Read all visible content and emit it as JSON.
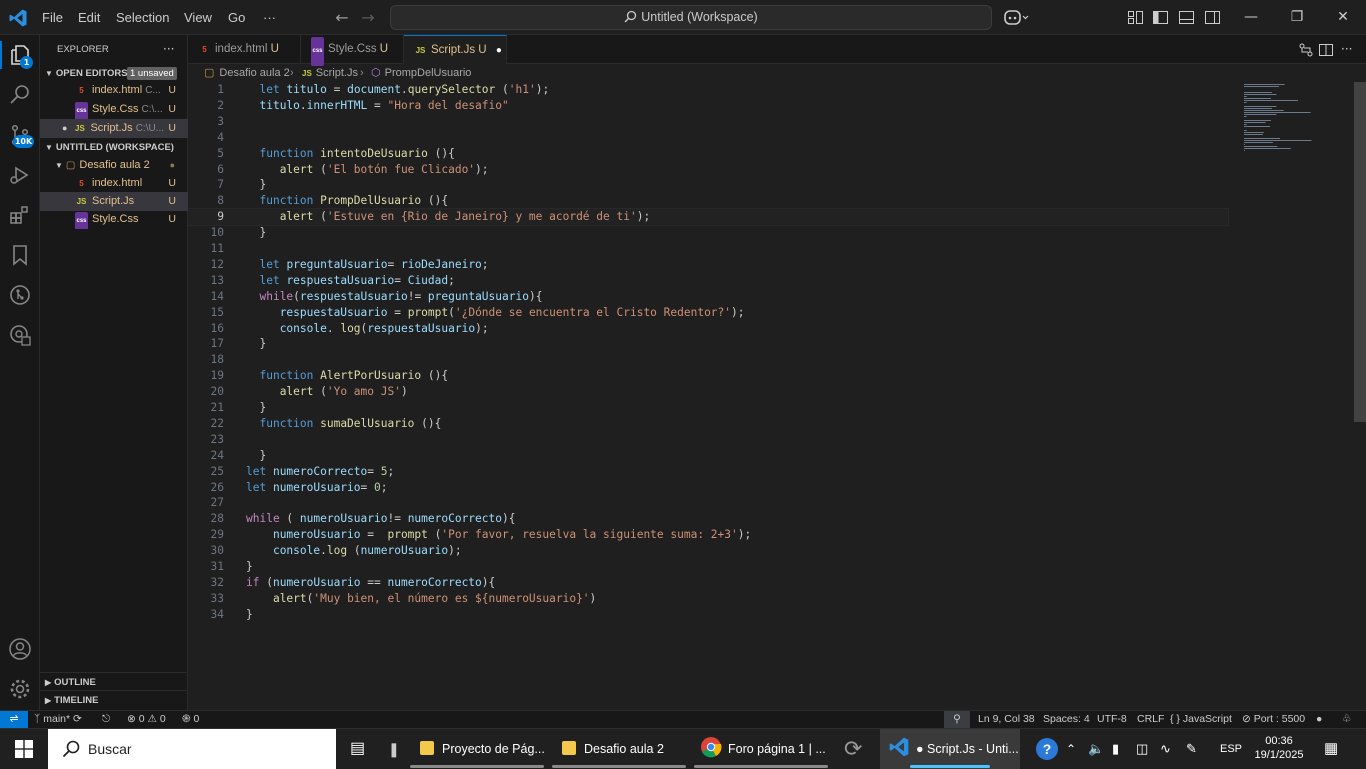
{
  "menu": [
    "File",
    "Edit",
    "Selection",
    "View",
    "Go",
    "···"
  ],
  "search": {
    "text": "Untitled (Workspace)"
  },
  "activity_badges": {
    "source_control": "10K",
    "explorer": "1"
  },
  "sidebar": {
    "title": "EXPLORER",
    "open_editors": {
      "label": "OPEN EDITORS",
      "unsaved": "1 unsaved"
    },
    "open_files": [
      {
        "icon": "5",
        "name": "index.html",
        "path": "C...",
        "status": "U"
      },
      {
        "icon": "css",
        "name": "Style.Css",
        "path": "C:\\...",
        "status": "U"
      },
      {
        "icon": "JS",
        "name": "Script.Js",
        "path": "C:\\U...",
        "status": "U",
        "dot": "●"
      }
    ],
    "workspace": {
      "label": "UNTITLED (WORKSPACE)",
      "folder": "Desafio aula 2",
      "folder_dot": "●"
    },
    "files": [
      {
        "icon": "5",
        "name": "index.html",
        "status": "U"
      },
      {
        "icon": "JS",
        "name": "Script.Js",
        "status": "U"
      },
      {
        "icon": "css",
        "name": "Style.Css",
        "status": "U"
      }
    ],
    "outline": "OUTLINE",
    "timeline": "TIMELINE"
  },
  "tabs": [
    {
      "icon": "5",
      "name": "index.html",
      "status": "U"
    },
    {
      "icon": "css",
      "name": "Style.Css",
      "status": "U"
    },
    {
      "icon": "JS",
      "name": "Script.Js",
      "status": "U",
      "dot": "●"
    }
  ],
  "breadcrumb": {
    "folder": "Desafio aula 2",
    "file_icon": "JS",
    "file": "Script.Js",
    "symbol": "PrompDelUsuario"
  },
  "code": [
    [
      [
        "  ",
        ""
      ],
      [
        "let ",
        "kw"
      ],
      [
        "titulo",
        "var"
      ],
      [
        " = ",
        ""
      ],
      [
        "document",
        "var"
      ],
      [
        ".",
        ""
      ],
      [
        "querySelector",
        "fn"
      ],
      [
        " (",
        ""
      ],
      [
        "'h1'",
        "str"
      ],
      [
        ");",
        ""
      ]
    ],
    [
      [
        "  ",
        ""
      ],
      [
        "titulo",
        "var"
      ],
      [
        ".",
        ""
      ],
      [
        "innerHTML",
        "var"
      ],
      [
        " = ",
        ""
      ],
      [
        "\"Hora del desafio\"",
        "str"
      ]
    ],
    [],
    [],
    [
      [
        "  ",
        ""
      ],
      [
        "function ",
        "kw"
      ],
      [
        "intentoDeUsuario",
        "fn"
      ],
      [
        " ()",
        ""
      ],
      [
        "{",
        ""
      ]
    ],
    [
      [
        "     ",
        ""
      ],
      [
        "alert",
        "fn"
      ],
      [
        " (",
        ""
      ],
      [
        "'El botón fue Clicado'",
        "str"
      ],
      [
        ");",
        ""
      ]
    ],
    [
      [
        "  ",
        ""
      ],
      [
        "}",
        ""
      ]
    ],
    [
      [
        "  ",
        ""
      ],
      [
        "function ",
        "kw"
      ],
      [
        "PrompDelUsuario",
        "fn"
      ],
      [
        " ()",
        ""
      ],
      [
        "{",
        ""
      ]
    ],
    [
      [
        "     ",
        ""
      ],
      [
        "alert",
        "fn"
      ],
      [
        " (",
        ""
      ],
      [
        "'Estuve en {Rio de Janeiro} y me acordé de ti'",
        "str"
      ],
      [
        ");",
        ""
      ]
    ],
    [
      [
        "  ",
        ""
      ],
      [
        "}",
        ""
      ]
    ],
    [],
    [
      [
        "  ",
        ""
      ],
      [
        "let ",
        "kw"
      ],
      [
        "preguntaUsuario",
        "var"
      ],
      [
        "= ",
        ""
      ],
      [
        "rioDeJaneiro",
        "var"
      ],
      [
        ";",
        ""
      ]
    ],
    [
      [
        "  ",
        ""
      ],
      [
        "let ",
        "kw"
      ],
      [
        "respuestaUsuario",
        "var"
      ],
      [
        "= ",
        ""
      ],
      [
        "Ciudad",
        "var"
      ],
      [
        ";",
        ""
      ]
    ],
    [
      [
        "  ",
        ""
      ],
      [
        "while",
        "ctl"
      ],
      [
        "(",
        ""
      ],
      [
        "respuestaUsuario",
        "var"
      ],
      [
        "!= ",
        ""
      ],
      [
        "preguntaUsuario",
        "var"
      ],
      [
        "){",
        ""
      ]
    ],
    [
      [
        "     ",
        ""
      ],
      [
        "respuestaUsuario",
        "var"
      ],
      [
        " = ",
        ""
      ],
      [
        "prompt",
        "fn"
      ],
      [
        "(",
        ""
      ],
      [
        "'¿Dónde se encuentra el Cristo Redentor?'",
        "str"
      ],
      [
        ");",
        ""
      ]
    ],
    [
      [
        "     ",
        ""
      ],
      [
        "console",
        "var"
      ],
      [
        ". ",
        ""
      ],
      [
        "log",
        "fn"
      ],
      [
        "(",
        ""
      ],
      [
        "respuestaUsuario",
        "var"
      ],
      [
        ");",
        ""
      ]
    ],
    [
      [
        "  ",
        ""
      ],
      [
        "}",
        ""
      ]
    ],
    [],
    [
      [
        "  ",
        ""
      ],
      [
        "function ",
        "kw"
      ],
      [
        "AlertPorUsuario",
        "fn"
      ],
      [
        " ()",
        ""
      ],
      [
        "{",
        ""
      ]
    ],
    [
      [
        "     ",
        ""
      ],
      [
        "alert",
        "fn"
      ],
      [
        " (",
        ""
      ],
      [
        "'Yo amo JS'",
        "str"
      ],
      [
        ")",
        ""
      ]
    ],
    [
      [
        "  ",
        ""
      ],
      [
        "}",
        ""
      ]
    ],
    [
      [
        "  ",
        ""
      ],
      [
        "function ",
        "kw"
      ],
      [
        "sumaDelUsuario",
        "fn"
      ],
      [
        " ()",
        ""
      ],
      [
        "{",
        ""
      ]
    ],
    [],
    [
      [
        "  ",
        ""
      ],
      [
        "}",
        ""
      ]
    ],
    [
      [
        "let ",
        "kw"
      ],
      [
        "numeroCorrecto",
        "var"
      ],
      [
        "= ",
        ""
      ],
      [
        "5",
        "num"
      ],
      [
        ";",
        ""
      ]
    ],
    [
      [
        "let ",
        "kw"
      ],
      [
        "numeroUsuario",
        "var"
      ],
      [
        "= ",
        ""
      ],
      [
        "0",
        "num"
      ],
      [
        ";",
        ""
      ]
    ],
    [],
    [
      [
        "while",
        "ctl"
      ],
      [
        " ( ",
        ""
      ],
      [
        "numeroUsuario",
        "var"
      ],
      [
        "!= ",
        ""
      ],
      [
        "numeroCorrecto",
        "var"
      ],
      [
        "){",
        ""
      ]
    ],
    [
      [
        "    ",
        ""
      ],
      [
        "numeroUsuario",
        "var"
      ],
      [
        " =  ",
        ""
      ],
      [
        "prompt",
        "fn"
      ],
      [
        " (",
        ""
      ],
      [
        "'Por favor, resuelva la siguiente suma: 2+3'",
        "str"
      ],
      [
        ");",
        ""
      ]
    ],
    [
      [
        "    ",
        ""
      ],
      [
        "console",
        "var"
      ],
      [
        ".",
        ""
      ],
      [
        "log",
        "fn"
      ],
      [
        " (",
        ""
      ],
      [
        "numeroUsuario",
        "var"
      ],
      [
        ");",
        ""
      ]
    ],
    [
      [
        "}",
        ""
      ]
    ],
    [
      [
        "if",
        "ctl"
      ],
      [
        " (",
        ""
      ],
      [
        "numeroUsuario",
        "var"
      ],
      [
        " == ",
        ""
      ],
      [
        "numeroCorrecto",
        "var"
      ],
      [
        "){",
        ""
      ]
    ],
    [
      [
        "    ",
        ""
      ],
      [
        "alert",
        "fn"
      ],
      [
        "(",
        ""
      ],
      [
        "'Muy bien, el número es ${numeroUsuario}'",
        "str"
      ],
      [
        ")",
        ""
      ]
    ],
    [
      [
        "}",
        ""
      ]
    ]
  ],
  "current_line": 9,
  "status": {
    "branch": "main*",
    "errors": "0",
    "warnings": "0",
    "ports_count": "0",
    "position": "Ln 9, Col 38",
    "spaces": "Spaces: 4",
    "encoding": "UTF-8",
    "eol": "CRLF",
    "language": "JavaScript",
    "port": "Port : 5500"
  },
  "taskbar": {
    "search": "Buscar",
    "apps": [
      {
        "label": "Proyecto de Pág..."
      },
      {
        "label": "Desafio aula 2"
      },
      {
        "label": "Foro página 1 | ..."
      },
      {
        "label": "● Script.Js - Unti..."
      }
    ],
    "lang": "ESP",
    "time": "00:36",
    "date": "19/1/2025"
  },
  "colors": {
    "accent": "#0078d4",
    "modified": "#e2c08d",
    "js": "#cbcb41",
    "html": "#e34c26",
    "css": "#663399"
  }
}
